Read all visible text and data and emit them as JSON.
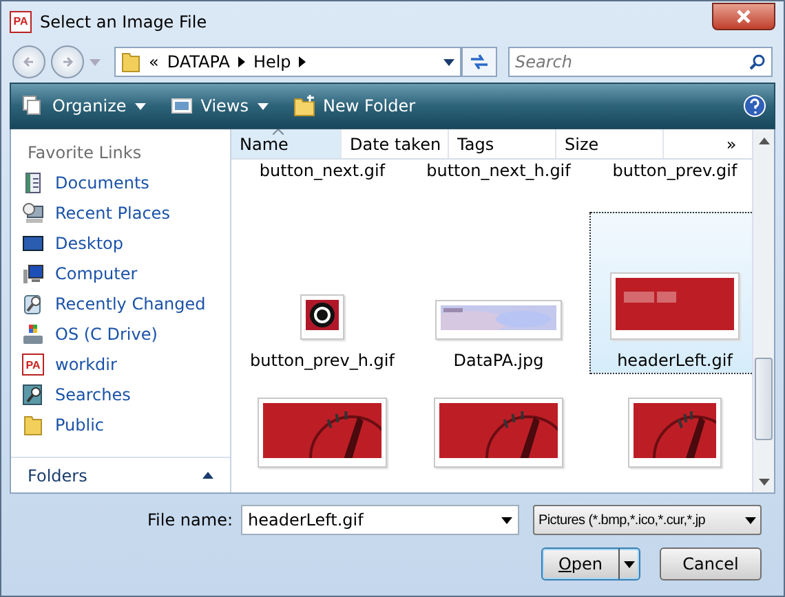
{
  "window": {
    "title": "Select an Image File",
    "app_badge": "PA"
  },
  "address": {
    "overflow": "«",
    "segments": [
      "DATAPA",
      "Help"
    ]
  },
  "search": {
    "placeholder": "Search"
  },
  "toolbar": [
    {
      "label": "Organize",
      "kind": "organize",
      "menu": true
    },
    {
      "label": "Views",
      "kind": "views",
      "menu": true
    },
    {
      "label": "New Folder",
      "kind": "newfolder",
      "menu": false
    }
  ],
  "sidebar": {
    "header": "Favorite Links",
    "items": [
      {
        "label": "Documents",
        "kind": "documents"
      },
      {
        "label": "Recent Places",
        "kind": "recent"
      },
      {
        "label": "Desktop",
        "kind": "desktop"
      },
      {
        "label": "Computer",
        "kind": "computer"
      },
      {
        "label": "Recently Changed",
        "kind": "changed"
      },
      {
        "label": "OS (C Drive)",
        "kind": "drive"
      },
      {
        "label": "workdir",
        "kind": "app",
        "badge": "PA"
      },
      {
        "label": "Searches",
        "kind": "searches"
      },
      {
        "label": "Public",
        "kind": "folder"
      }
    ],
    "folders": {
      "label": "Folders",
      "expanded": true
    }
  },
  "columns": [
    {
      "label": "Name",
      "sorted": true
    },
    {
      "label": "Date taken",
      "sorted": false
    },
    {
      "label": "Tags",
      "sorted": false
    },
    {
      "label": "Size",
      "sorted": false
    }
  ],
  "more_columns": "»",
  "files": [
    {
      "name": "button_next.gif",
      "kind": "label",
      "selected": false
    },
    {
      "name": "button_next_h.gif",
      "kind": "label",
      "selected": false
    },
    {
      "name": "button_prev.gif",
      "kind": "label",
      "selected": false
    },
    {
      "name": "button_prev_h.gif",
      "kind": "button",
      "selected": false
    },
    {
      "name": "DataPA.jpg",
      "kind": "light",
      "selected": false
    },
    {
      "name": "headerLeft.gif",
      "kind": "banner",
      "selected": true
    },
    {
      "kind": "clock",
      "selected": false
    },
    {
      "kind": "clock",
      "selected": false
    },
    {
      "kind": "clocksmall",
      "selected": false
    }
  ],
  "file_name": {
    "label": "File name:",
    "value": "headerLeft.gif"
  },
  "filter": {
    "value": "Pictures (*.bmp,*.ico,*.cur,*.jp"
  },
  "buttons": [
    {
      "label": "Open",
      "underline_first": true,
      "split": true,
      "default": true
    },
    {
      "label": "Cancel",
      "underline_first": false,
      "split": false,
      "default": false
    }
  ]
}
